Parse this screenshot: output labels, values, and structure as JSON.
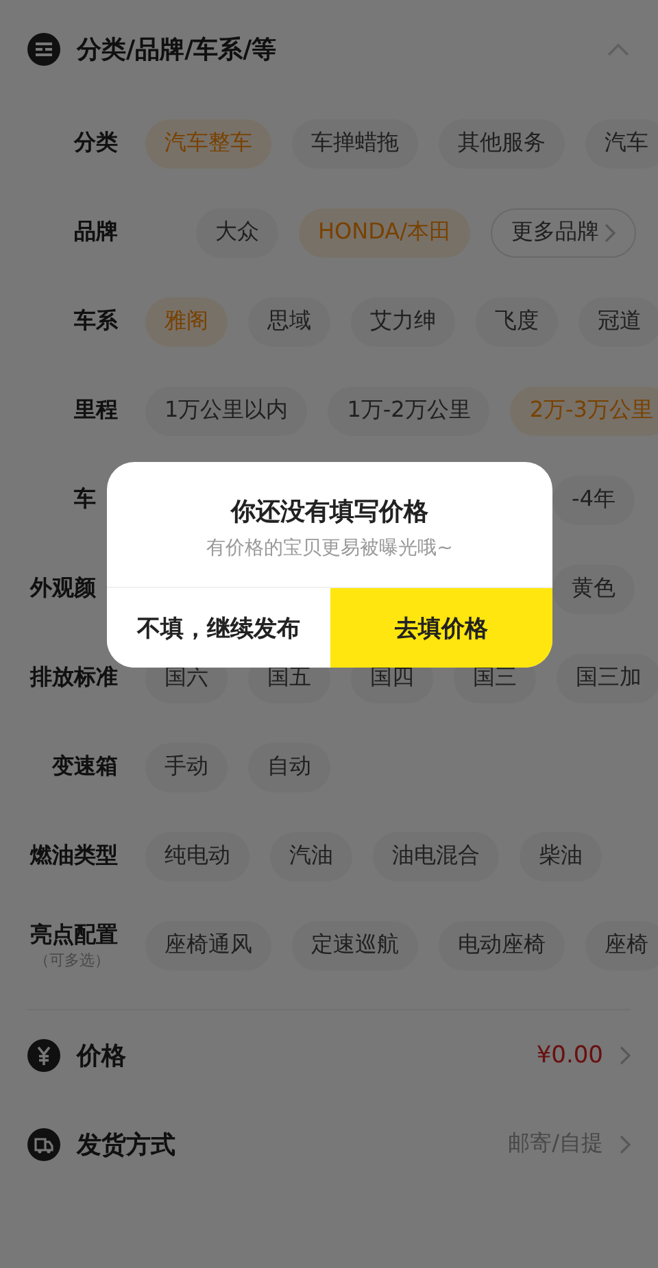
{
  "section": {
    "title": "分类/品牌/车系/等",
    "expanded": true
  },
  "rows": [
    {
      "kind": "plain",
      "label": "分类",
      "chips": [
        {
          "label": "汽车整车",
          "selected": true
        },
        {
          "label": "车掸蜡拖",
          "selected": false
        },
        {
          "label": "其他服务",
          "selected": false
        },
        {
          "label": "汽车",
          "selected": false
        }
      ]
    },
    {
      "kind": "scrolled",
      "label": "品牌",
      "chips": [
        {
          "label": "大众",
          "selected": false
        },
        {
          "label": "HONDA/本田",
          "selected": true
        }
      ],
      "more": "更多品牌"
    },
    {
      "kind": "plain",
      "label": "车系",
      "chips": [
        {
          "label": "雅阁",
          "selected": true
        },
        {
          "label": "思域",
          "selected": false
        },
        {
          "label": "艾力绅",
          "selected": false
        },
        {
          "label": "飞度",
          "selected": false
        },
        {
          "label": "冠道",
          "selected": false
        }
      ]
    },
    {
      "kind": "plain",
      "label": "里程",
      "chips": [
        {
          "label": "1万公里以内",
          "selected": false
        },
        {
          "label": "1万-2万公里",
          "selected": false
        },
        {
          "label": "2万-3万公里",
          "selected": true
        }
      ]
    },
    {
      "kind": "covered",
      "label": "车",
      "chips": [
        {
          "label": "-4年",
          "selected": false
        }
      ]
    },
    {
      "kind": "covered",
      "label": "外观颜",
      "chips": [
        {
          "label": "黄色",
          "selected": false
        }
      ]
    },
    {
      "kind": "plain",
      "label": "排放标准",
      "chips": [
        {
          "label": "国六",
          "selected": false
        },
        {
          "label": "国五",
          "selected": false
        },
        {
          "label": "国四",
          "selected": false
        },
        {
          "label": "国三",
          "selected": false
        },
        {
          "label": "国三加",
          "selected": false
        }
      ]
    },
    {
      "kind": "plain",
      "label": "变速箱",
      "chips": [
        {
          "label": "手动",
          "selected": false
        },
        {
          "label": "自动",
          "selected": false
        }
      ]
    },
    {
      "kind": "plain",
      "label": "燃油类型",
      "chips": [
        {
          "label": "纯电动",
          "selected": false
        },
        {
          "label": "汽油",
          "selected": false
        },
        {
          "label": "油电混合",
          "selected": false
        },
        {
          "label": "柴油",
          "selected": false
        }
      ]
    },
    {
      "kind": "plain",
      "label": "亮点配置",
      "note": "（可多选）",
      "chips": [
        {
          "label": "座椅通风",
          "selected": false
        },
        {
          "label": "定速巡航",
          "selected": false
        },
        {
          "label": "电动座椅",
          "selected": false
        },
        {
          "label": "座椅",
          "selected": false
        }
      ]
    }
  ],
  "fields": [
    {
      "kind": "price",
      "label": "价格",
      "value": "¥0.00"
    },
    {
      "kind": "shipping",
      "label": "发货方式",
      "value": "邮寄/自提"
    }
  ],
  "dialog": {
    "title": "你还没有填写价格",
    "message": "有价格的宝贝更易被曝光哦~",
    "buttons": [
      {
        "label": "不填，继续发布",
        "primary": false
      },
      {
        "label": "去填价格",
        "primary": true
      }
    ]
  }
}
